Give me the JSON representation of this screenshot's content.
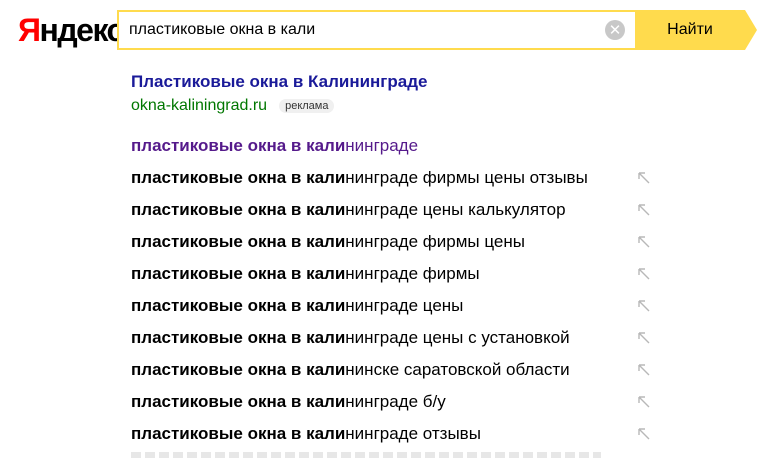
{
  "logo": {
    "first": "Я",
    "rest": "ндекс"
  },
  "search": {
    "value": "пластиковые окна в кали",
    "button_label": "Найти"
  },
  "ad": {
    "title": "Пластиковые окна в Калининграде",
    "url": "okna-kaliningrad.ru",
    "badge": "реклама"
  },
  "suggestions": [
    {
      "typed": "пластиковые окна в кали",
      "rest": "нинграде"
    },
    {
      "typed": "пластиковые окна в кали",
      "rest": "нинграде фирмы цены отзывы"
    },
    {
      "typed": "пластиковые окна в кали",
      "rest": "нинграде цены калькулятор"
    },
    {
      "typed": "пластиковые окна в кали",
      "rest": "нинграде фирмы цены"
    },
    {
      "typed": "пластиковые окна в кали",
      "rest": "нинграде фирмы"
    },
    {
      "typed": "пластиковые окна в кали",
      "rest": "нинграде цены"
    },
    {
      "typed": "пластиковые окна в кали",
      "rest": "нинграде цены с установкой"
    },
    {
      "typed": "пластиковые окна в кали",
      "rest": "нинске саратовской области"
    },
    {
      "typed": "пластиковые окна в кали",
      "rest": "нинграде б/у"
    },
    {
      "typed": "пластиковые окна в кали",
      "rest": "нинграде отзывы"
    }
  ],
  "icons": {
    "clear": "clear-icon",
    "fill": "fill-suggestion-arrow-icon"
  },
  "colors": {
    "accent": "#ffdb4d",
    "ad_title": "#1a1a99",
    "ad_url": "#007700",
    "visited": "#551a8b",
    "logo_red": "#ff0000"
  }
}
